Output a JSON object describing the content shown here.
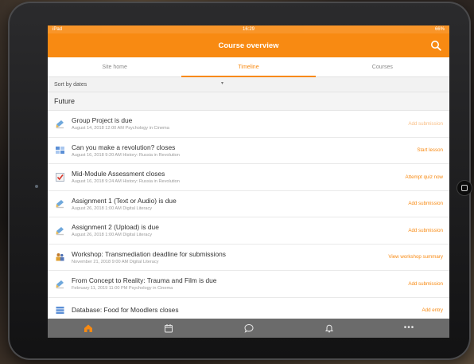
{
  "status_bar": {
    "left": "iPad",
    "time": "16:29",
    "battery": "66%"
  },
  "header": {
    "title": "Course overview"
  },
  "tabs": [
    {
      "label": "Site home",
      "active": false
    },
    {
      "label": "Timeline",
      "active": true
    },
    {
      "label": "Courses",
      "active": false
    }
  ],
  "sort": {
    "label": "Sort by dates"
  },
  "section": {
    "title": "Future"
  },
  "items": [
    {
      "icon": "assignment-icon",
      "title": "Group Project is due",
      "meta": "August 14, 2018 12:00 AM Psychology in Cinema",
      "action": "Add submission",
      "faded": true
    },
    {
      "icon": "lesson-icon",
      "title": "Can you make a revolution? closes",
      "meta": "August 16, 2018 9:20 AM History: Russia in Revolution",
      "action": "Start lesson",
      "faded": false
    },
    {
      "icon": "quiz-icon",
      "title": "Mid-Module Assessment closes",
      "meta": "August 16, 2018 9:24 AM History: Russia in Revolution",
      "action": "Attempt quiz now",
      "faded": false
    },
    {
      "icon": "assignment-icon",
      "title": "Assignment 1 (Text or Audio) is due",
      "meta": "August 26, 2018 1:00 AM Digital Literacy",
      "action": "Add submission",
      "faded": false
    },
    {
      "icon": "assignment-icon",
      "title": "Assignment 2 (Upload) is due",
      "meta": "August 26, 2018 1:00 AM Digital Literacy",
      "action": "Add submission",
      "faded": false
    },
    {
      "icon": "workshop-icon",
      "title": "Workshop: Transmediation deadline for submissions",
      "meta": "November 21, 2018 9:00 AM Digital Literacy",
      "action": "View workshop summary",
      "faded": false
    },
    {
      "icon": "assignment-icon",
      "title": "From Concept to Reality: Trauma and Film is due",
      "meta": "February 11, 2019 11:00 PM Psychology in Cinema",
      "action": "Add submission",
      "faded": false
    },
    {
      "icon": "database-icon",
      "title": "Database: Food for Moodlers closes",
      "meta": "",
      "action": "Add entry",
      "faded": false
    }
  ],
  "colors": {
    "accent": "#f88a12",
    "bottom_bar": "#6b6b6b"
  }
}
